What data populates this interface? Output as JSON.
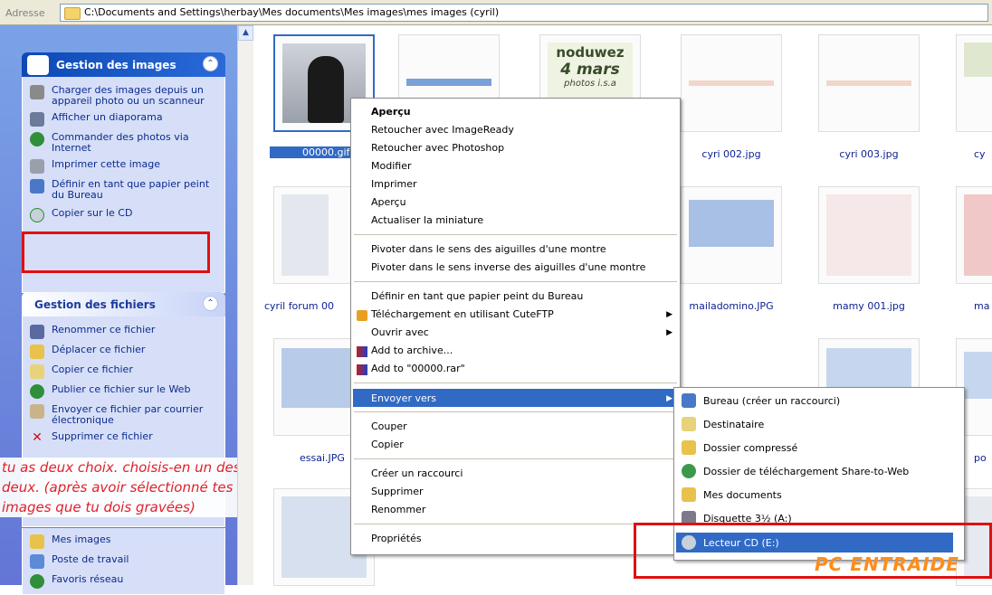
{
  "address_bar": {
    "label": "Adresse",
    "path": "C:\\Documents and Settings\\herbay\\Mes documents\\Mes images\\mes images (cyril)"
  },
  "task_pane": {
    "image_tasks": {
      "title": "Gestion des images",
      "items": [
        {
          "label": "Charger des images depuis un appareil photo ou un scanneur",
          "icon": "camera-icon"
        },
        {
          "label": "Afficher un diaporama",
          "icon": "slideshow-icon"
        },
        {
          "label": "Commander des photos via Internet",
          "icon": "globe-icon"
        },
        {
          "label": "Imprimer cette image",
          "icon": "printer-icon"
        },
        {
          "label": "Définir en tant que papier peint du Bureau",
          "icon": "wallpaper-icon"
        },
        {
          "label": "Copier sur le CD",
          "icon": "cd-copy-icon"
        }
      ]
    },
    "file_tasks": {
      "title": "Gestion des fichiers",
      "items": [
        {
          "label": "Renommer ce fichier",
          "icon": "rename-icon"
        },
        {
          "label": "Déplacer ce fichier",
          "icon": "move-icon"
        },
        {
          "label": "Copier ce fichier",
          "icon": "copy-icon"
        },
        {
          "label": "Publier ce fichier sur le Web",
          "icon": "web-publish-icon"
        },
        {
          "label": "Envoyer ce fichier par courrier électronique",
          "icon": "email-icon"
        },
        {
          "label": "Supprimer ce fichier",
          "icon": "delete-icon"
        }
      ]
    },
    "other_places": [
      {
        "label": "Mes images",
        "icon": "my-pictures-icon"
      },
      {
        "label": "Poste de travail",
        "icon": "my-computer-icon"
      },
      {
        "label": "Favoris réseau",
        "icon": "network-icon"
      }
    ]
  },
  "annotation_note": {
    "lines": [
      "tu as deux choix. choisis-en un des",
      "deux. (après avoir sélectionné tes",
      "images que tu dois gravées)"
    ]
  },
  "thumbnails": {
    "row1": [
      "00000.gif",
      "",
      "cyri 002.jpg",
      "cyri 003.jpg",
      "cy"
    ],
    "row2": [
      "cyril forum 00",
      "",
      "mailadomino.JPG",
      "mamy 001.jpg",
      "ma"
    ],
    "row3": [
      "essai.JPG",
      "",
      "",
      "",
      "po"
    ],
    "noduwez_text": [
      "noduwez",
      "4 mars",
      "photos i.s.a"
    ]
  },
  "context_menu": {
    "items": [
      {
        "label": "Aperçu",
        "bold": true
      },
      {
        "label": "Retoucher avec ImageReady"
      },
      {
        "label": "Retoucher avec Photoshop"
      },
      {
        "label": "Modifier"
      },
      {
        "label": "Imprimer"
      },
      {
        "label": "Aperçu"
      },
      {
        "label": "Actualiser la miniature"
      },
      {
        "label": "Pivoter dans le sens des aiguilles d'une montre"
      },
      {
        "label": "Pivoter dans le sens inverse des aiguilles d'une montre"
      },
      {
        "label": "Définir en tant que papier peint du Bureau"
      },
      {
        "label": "Téléchargement en utilisant CuteFTP",
        "submenu": true
      },
      {
        "label": "Ouvrir avec",
        "submenu": true
      },
      {
        "label": "Add to archive..."
      },
      {
        "label": "Add to \"00000.rar\""
      },
      {
        "label": "Envoyer vers",
        "submenu": true,
        "highlighted": true
      },
      {
        "label": "Couper"
      },
      {
        "label": "Copier"
      },
      {
        "label": "Créer un raccourci"
      },
      {
        "label": "Supprimer"
      },
      {
        "label": "Renommer"
      },
      {
        "label": "Propriétés"
      }
    ]
  },
  "send_to_menu": {
    "items": [
      {
        "label": "Bureau (créer un raccourci)",
        "icon": "desktop-icon"
      },
      {
        "label": "Destinataire",
        "icon": "mail-recipient-icon"
      },
      {
        "label": "Dossier compressé",
        "icon": "zip-folder-icon"
      },
      {
        "label": "Dossier de téléchargement Share-to-Web",
        "icon": "share-web-icon"
      },
      {
        "label": "Mes documents",
        "icon": "my-documents-icon"
      },
      {
        "label": "Disquette 3½ (A:)",
        "icon": "floppy-icon"
      },
      {
        "label": "Lecteur CD (E:)",
        "icon": "cd-drive-icon",
        "highlighted": true
      }
    ]
  },
  "watermark": {
    "text": "PC ENTRAIDE"
  },
  "colors": {
    "selection": "#316ac5",
    "annotation": "#e01010",
    "task_link": "#0c2a8f",
    "watermark": "#ff8c1a"
  }
}
